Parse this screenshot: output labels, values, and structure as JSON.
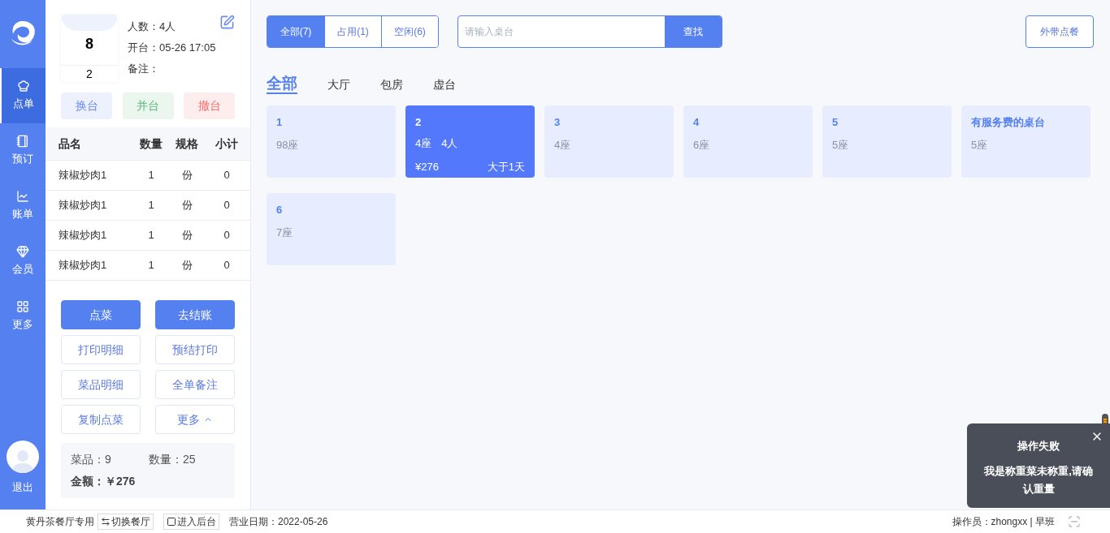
{
  "sidebar": {
    "items": [
      {
        "label": "点单",
        "selected": true
      },
      {
        "label": "预订",
        "selected": false
      },
      {
        "label": "账单",
        "selected": false
      },
      {
        "label": "会员",
        "selected": false
      },
      {
        "label": "更多",
        "selected": false
      }
    ],
    "logout": "退出"
  },
  "order_panel": {
    "table_number": "8",
    "table_name": "2",
    "info": [
      "人数：4人",
      "开台：05-26 17:05",
      "备注："
    ],
    "table_actions": [
      {
        "label": "换台",
        "color": "#6b8af0"
      },
      {
        "label": "并台",
        "color": "#5cb87a"
      },
      {
        "label": "撤台",
        "color": "#f56c6c"
      }
    ],
    "columns": [
      "品名",
      "数量",
      "规格",
      "小计"
    ],
    "rows": [
      [
        "辣椒炒肉1",
        "1",
        "份",
        "0"
      ],
      [
        "辣椒炒肉1",
        "1",
        "份",
        "0"
      ],
      [
        "辣椒炒肉1",
        "1",
        "份",
        "0"
      ],
      [
        "辣椒炒肉1",
        "1",
        "份",
        "0"
      ]
    ],
    "buttons": [
      {
        "label": "点菜",
        "kind": "primary"
      },
      {
        "label": "去结账",
        "kind": "primary"
      },
      {
        "label": "打印明细",
        "kind": "outline"
      },
      {
        "label": "预结打印",
        "kind": "outline"
      },
      {
        "label": "菜品明细",
        "kind": "outline"
      },
      {
        "label": "全单备注",
        "kind": "outline"
      },
      {
        "label": "复制点菜",
        "kind": "outline"
      },
      {
        "label": "更多",
        "kind": "more"
      }
    ],
    "summary": {
      "dishes": "菜品：9",
      "quantity": "数量：25",
      "amount_label": "金额：",
      "amount": "￥276"
    }
  },
  "filters": [
    {
      "label": "全部(7)",
      "selected": true
    },
    {
      "label": "占用(1)",
      "selected": false
    },
    {
      "label": "空闲(6)",
      "selected": false
    }
  ],
  "search": {
    "placeholder": "请输入桌台",
    "button": "查找"
  },
  "takeout_button": "外带点餐",
  "areas": [
    {
      "label": "全部",
      "selected": true
    },
    {
      "label": "大厅",
      "selected": false
    },
    {
      "label": "包房",
      "selected": false
    },
    {
      "label": "虚台",
      "selected": false
    }
  ],
  "tables": [
    {
      "name": "1",
      "seats": "98座",
      "occupied": false
    },
    {
      "name": "2",
      "seats": "4座",
      "people": "4人",
      "amount": "¥276",
      "duration": "大于1天",
      "occupied": true
    },
    {
      "name": "3",
      "seats": "4座",
      "occupied": false
    },
    {
      "name": "4",
      "seats": "6座",
      "occupied": false
    },
    {
      "name": "5",
      "seats": "5座",
      "occupied": false
    },
    {
      "name": "有服务费的桌台",
      "seats": "5座",
      "occupied": false
    },
    {
      "name": "6",
      "seats": "7座",
      "occupied": false
    }
  ],
  "status_bar": {
    "restaurant": "黄丹茶餐厅专用",
    "switch": "切换餐厅",
    "backend": "进入后台",
    "business_date": "营业日期：2022-05-26",
    "operator": "操作员：zhongxx | 早班"
  },
  "toast": {
    "title": "操作失败",
    "message": "我是称重菜未称重,请确认重量"
  }
}
